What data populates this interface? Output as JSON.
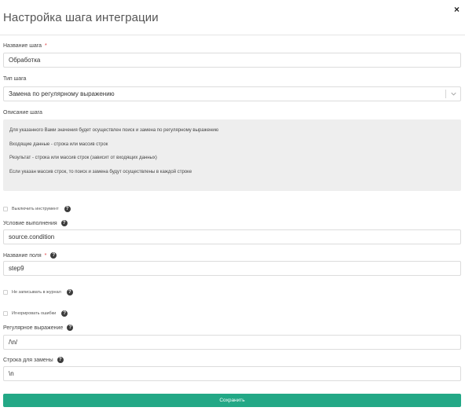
{
  "modal": {
    "title": "Настройка шага интеграции",
    "close_symbol": "×"
  },
  "fields": {
    "step_name": {
      "label": "Название шага",
      "required_mark": "*",
      "value": "Обработка"
    },
    "step_type": {
      "label": "Тип шага",
      "value": "Замена по регулярному выражению"
    },
    "step_description": {
      "label": "Описание шага",
      "lines": [
        "Для указанного Вами значения будет осуществлен поиск и замена по регулярному выражению",
        "Входящие данные - строка или массив строк",
        "Результат - строка или массив строк (зависит от входящих данных)",
        "Если указан массив строк, то поиск и замена будут осуществлены в каждой строке"
      ]
    },
    "disable_tool": {
      "label": "Выключить инструмент",
      "checked": false
    },
    "execution_condition": {
      "label": "Условие выполнения",
      "value": "source.condition"
    },
    "field_name": {
      "label": "Название поля",
      "required_mark": "*",
      "value": "step9"
    },
    "no_journal": {
      "label": "Не записывать в журнал",
      "checked": false
    },
    "ignore_errors": {
      "label": "Игнорировать ошибки",
      "checked": false
    },
    "regex": {
      "label": "Регулярное выражение",
      "value": "/\\n/"
    },
    "replacement": {
      "label": "Строка для замены",
      "value": "\\n"
    }
  },
  "help_icon_glyph": "?",
  "actions": {
    "save_label": "Сохранить"
  },
  "colors": {
    "accent": "#23a886",
    "required": "#e03a3a",
    "description_bg": "#eeeeee"
  },
  "icons": {
    "close": "close-icon",
    "help": "question-circle-icon",
    "dropdown": "chevron-down-icon"
  }
}
